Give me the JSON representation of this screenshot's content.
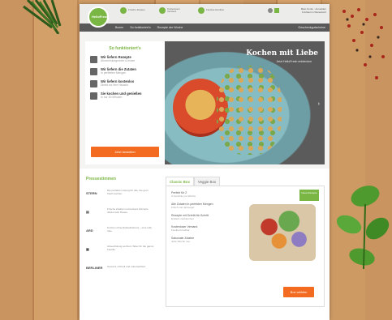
{
  "header": {
    "logo_text": "HelloFresh",
    "usps": [
      "Frische Zutaten",
      "Kostenloser Versand",
      "Flexibel kündbar"
    ],
    "account_line1": "Mein Konto · Anmelden",
    "account_line2": "0 Artikel im Warenkorb"
  },
  "nav": {
    "items": [
      "Boxen",
      "So funktioniert's",
      "Rezepte der Woche"
    ],
    "right": "Geschenkgutscheine"
  },
  "how": {
    "title": "So funktioniert's",
    "steps": [
      {
        "title": "Wir liefern Rezepte",
        "sub": "Abwechslungsreich & lecker"
      },
      {
        "title": "Wir liefern die Zutaten",
        "sub": "In perfekten Mengen"
      },
      {
        "title": "Wir liefern kostenlos",
        "sub": "Direkt vor Ihre Haustür"
      },
      {
        "title": "Sie kochen und genießen",
        "sub": "In nur 30 Minuten"
      }
    ],
    "button": "Jetzt bestellen"
  },
  "hero": {
    "title": "Kochen mit Liebe",
    "subtitle": "Jetzt HelloFresh entdecken",
    "next_arrow": "›"
  },
  "press": {
    "title": "Pressestimmen",
    "items": [
      {
        "logo": "STERN",
        "text": "Die perfekte Lösung für alle, die gern frisch kochen."
      },
      {
        "logo": "▤",
        "text": "Frische Zutaten und leckere Rezepte direkt nach Hause."
      },
      {
        "logo": "ARD",
        "text": "Kochen ohne Einkaufsstress – eine tolle Idee."
      },
      {
        "logo": "▦",
        "text": "Abwechslung auf dem Teller für die ganze Familie."
      },
      {
        "logo": "BERLINER",
        "text": "Gesund, schnell und unkompliziert."
      }
    ]
  },
  "boxes": {
    "tabs": [
      "Classic Box",
      "Veggie Box"
    ],
    "items": [
      {
        "title": "Perfekt für 2",
        "sub": "3 Gerichte pro Woche"
      },
      {
        "title": "Alle Zutaten in perfekten Mengen",
        "sub": "Frisch vom Erzeuger"
      },
      {
        "title": "Rezepte mit Schritt-für-Schritt",
        "sub": "Einfach nachkochen"
      },
      {
        "title": "Kostenloser Versand",
        "sub": "Flexibel kündbar"
      },
      {
        "title": "Saisonale Zutaten",
        "sub": "Jede Woche neu"
      }
    ],
    "badge": "Neue Rezepte",
    "button": "Box wählen"
  }
}
